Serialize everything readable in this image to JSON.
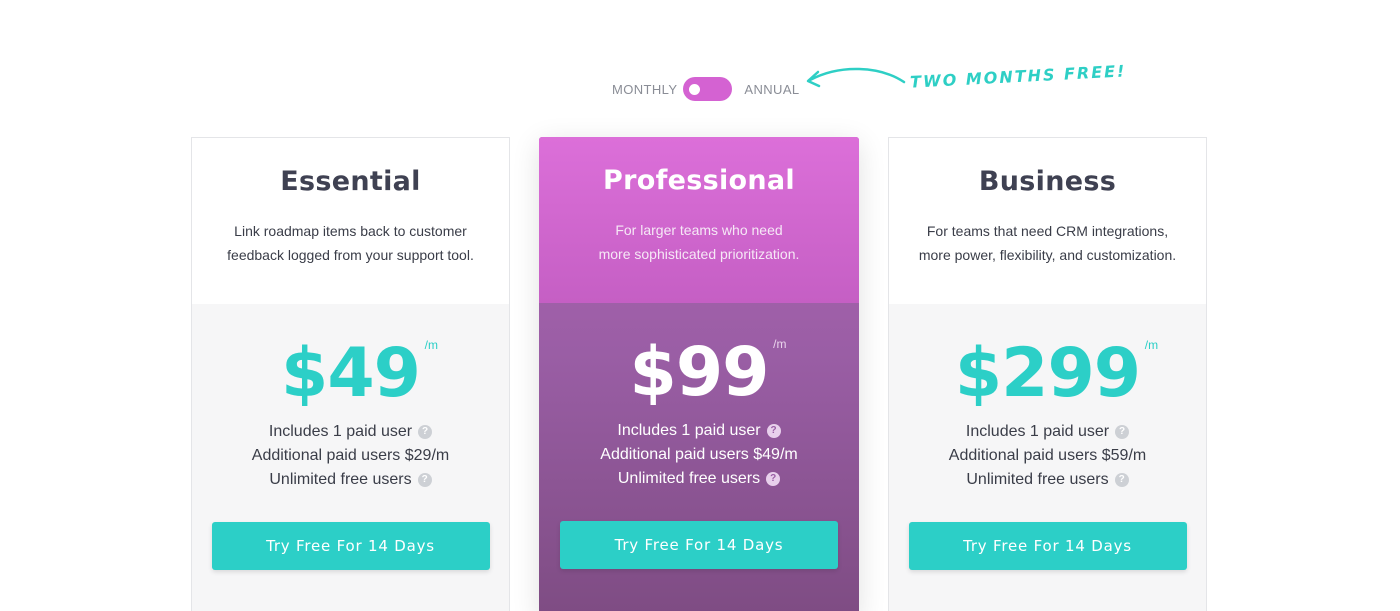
{
  "billing": {
    "monthly_label": "MONTHLY",
    "annual_label": "ANNUAL",
    "promo": "TWO MONTHS FREE!",
    "selected": "annual",
    "toggle_color": "#d462d2"
  },
  "colors": {
    "accent": "#2ccfc7",
    "featured_top": "#dc6fd9",
    "featured_bottom": "#7e4c83"
  },
  "plans": [
    {
      "name": "Essential",
      "desc_line1": "Link roadmap items back to customer",
      "desc_line2": "feedback logged from your support tool.",
      "price": "$49",
      "per": "/m",
      "feature1": "Includes 1 paid user",
      "feature2": "Additional paid users $29/m",
      "feature3": "Unlimited free users",
      "cta": "Try Free For 14 Days",
      "featured": false
    },
    {
      "name": "Professional",
      "desc_line1": "For larger teams who need",
      "desc_line2": "more sophisticated prioritization.",
      "price": "$99",
      "per": "/m",
      "feature1": "Includes 1 paid user",
      "feature2": "Additional paid users $49/m",
      "feature3": "Unlimited free users",
      "cta": "Try Free For 14 Days",
      "featured": true
    },
    {
      "name": "Business",
      "desc_line1": "For teams that need CRM integrations,",
      "desc_line2": "more power, flexibility, and customization.",
      "price": "$299",
      "per": "/m",
      "feature1": "Includes 1 paid user",
      "feature2": "Additional paid users $59/m",
      "feature3": "Unlimited free users",
      "cta": "Try Free For 14 Days",
      "featured": false
    }
  ],
  "help_glyph": "?"
}
